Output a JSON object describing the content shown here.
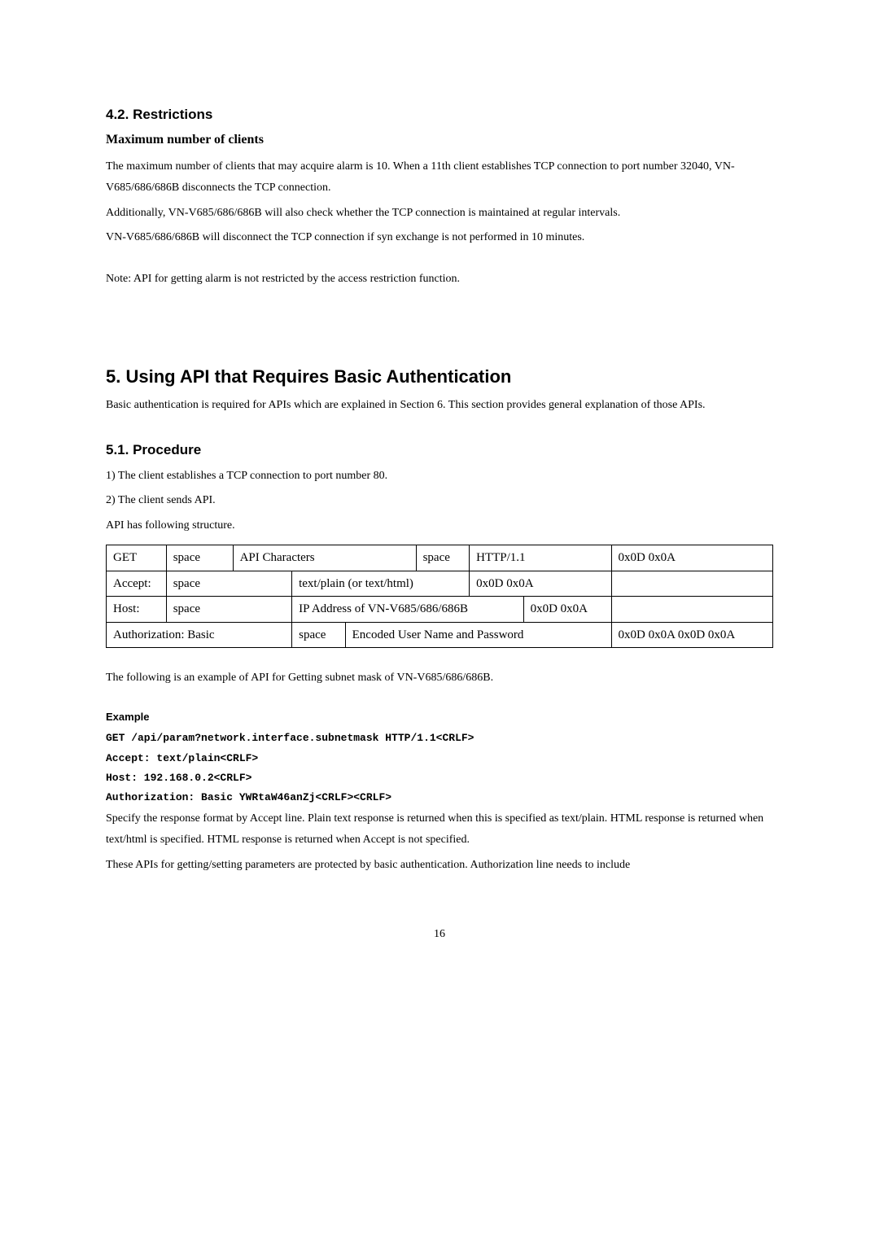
{
  "section42": {
    "heading": "4.2. Restrictions",
    "subheading": "Maximum number of clients",
    "p1": "The maximum number of clients that may acquire alarm is 10. When a 11th client establishes TCP connection to port number 32040, VN-V685/686/686B disconnects the TCP connection.",
    "p2": "Additionally, VN-V685/686/686B will also check whether the TCP connection is maintained at regular intervals.",
    "p3": "VN-V685/686/686B will disconnect the TCP connection if syn exchange is not performed in 10 minutes.",
    "note": "Note:  API for getting alarm is not restricted by the access restriction function."
  },
  "section5": {
    "heading": "5. Using API that Requires Basic Authentication",
    "intro": "Basic authentication is required for APIs which are explained in Section 6. This section provides general explanation of those APIs."
  },
  "section51": {
    "heading": "5.1. Procedure",
    "step1": "1) The client establishes a TCP connection to port number 80.",
    "step2": "2) The client sends API.",
    "step3": "API has following structure."
  },
  "table": {
    "r1c1": "GET",
    "r1c2": "space",
    "r1c3": "API Characters",
    "r1c4": "space",
    "r1c5": "HTTP/1.1",
    "r1c6": "0x0D 0x0A",
    "r2c1": "Accept:",
    "r2c2": "space",
    "r2c3": "text/plain (or text/html)",
    "r2c4": "0x0D 0x0A",
    "r3c1": "Host:",
    "r3c2": "space",
    "r3c3": "IP Address of VN-V685/686/686B",
    "r3c4": "0x0D 0x0A",
    "r4c1": "Authorization: Basic",
    "r4c2": "space",
    "r4c3": "Encoded User Name and Password",
    "r4c4": "0x0D 0x0A 0x0D 0x0A"
  },
  "postTable": "The following is an example of API for Getting subnet mask of VN-V685/686/686B.",
  "example": {
    "label": "Example",
    "line1": "GET /api/param?network.interface.subnetmask HTTP/1.1<CRLF>",
    "line2": "Accept: text/plain<CRLF>",
    "line3": "Host: 192.168.0.2<CRLF>",
    "line4": "Authorization: Basic YWRtaW46anZj<CRLF><CRLF>"
  },
  "trailing": {
    "p1": "Specify the response format by Accept line. Plain text response is returned when this is specified as text/plain. HTML response is returned when text/html is specified. HTML response is returned when Accept is not specified.",
    "p2": "These APIs for getting/setting parameters are protected by basic authentication. Authorization line needs to include"
  },
  "pageNumber": "16"
}
